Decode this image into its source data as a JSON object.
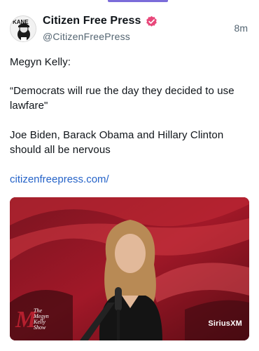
{
  "post": {
    "author": {
      "display_name": "Citizen Free Press",
      "handle": "@CitizenFreePress",
      "verified": true,
      "avatar_label": "KANE"
    },
    "timestamp": "8m",
    "text_lines": [
      "Megyn Kelly:",
      "“Democrats will rue the day they decided to use lawfare\"",
      "Joe Biden, Barack Obama and Hillary Clinton should all be nervous"
    ],
    "link": "citizenfreepress.com/",
    "media": {
      "type": "video-still",
      "watermark_left": "The\nMegyn\nKelly\nShow",
      "watermark_left_initial": "M",
      "watermark_right": "SiriusXM"
    }
  },
  "colors": {
    "accent": "#7b6cd9",
    "link": "#2563c8",
    "verified_badge": "#e8477a",
    "secondary_text": "#536471"
  }
}
